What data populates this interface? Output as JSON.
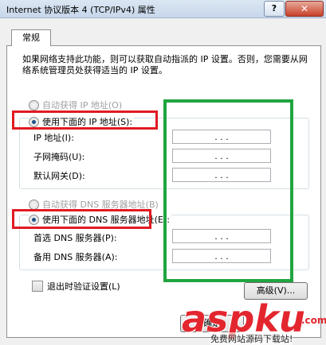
{
  "window": {
    "title": "Internet 协议版本 4 (TCP/IPv4) 属性",
    "help_label": "?",
    "close_label": "✕"
  },
  "tabs": [
    {
      "label": "常规"
    }
  ],
  "description": "如果网络支持此功能，则可以获取自动指派的 IP 设置。否则，您需要从网络系统管理员处获得适当的 IP 设置。",
  "ip_section": {
    "auto_label": "自动获得 IP 地址(O)",
    "manual_label": "使用下面的 IP 地址(S):",
    "selected": "manual",
    "fields": [
      {
        "label": "IP 地址(I):",
        "value": ". . ."
      },
      {
        "label": "子网掩码(U):",
        "value": ". . ."
      },
      {
        "label": "默认网关(D):",
        "value": ". . ."
      }
    ]
  },
  "dns_section": {
    "auto_label": "自动获得 DNS 服务器地址(B)",
    "manual_label": "使用下面的 DNS 服务器地址(E):",
    "selected": "manual",
    "fields": [
      {
        "label": "首选 DNS 服务器(P):",
        "value": ". . ."
      },
      {
        "label": "备用 DNS 服务器(A):",
        "value": ". . ."
      }
    ]
  },
  "validate_checkbox": {
    "label": "退出时验证设置(L)",
    "checked": false
  },
  "advanced_button": {
    "label": "高级(V)..."
  },
  "ok_button": {
    "label": "确定"
  },
  "watermark": {
    "text": "aspku",
    "suffix": ".com",
    "subtitle": "免费网站源码下载站!"
  },
  "colors": {
    "highlight_red": "#e11a22",
    "highlight_green": "#1fa53f"
  }
}
